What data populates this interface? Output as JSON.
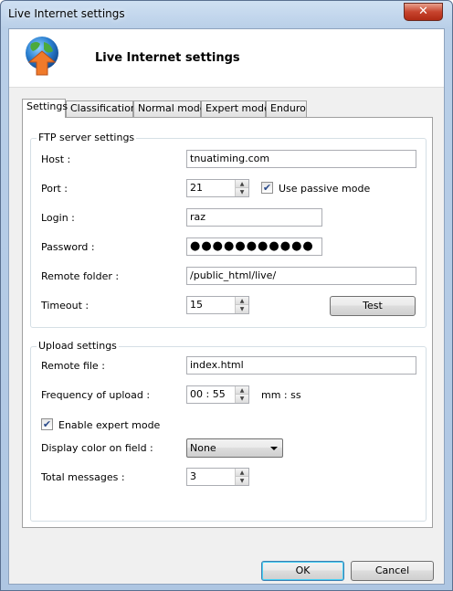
{
  "window": {
    "title": "Live Internet settings",
    "close_glyph": "✕"
  },
  "header": {
    "title": "Live Internet settings",
    "icon": "globe-upload-icon"
  },
  "tabs": [
    {
      "label": "Settings",
      "active": true
    },
    {
      "label": "Classification",
      "active": false
    },
    {
      "label": "Normal mode",
      "active": false
    },
    {
      "label": "Expert mode",
      "active": false
    },
    {
      "label": "Enduro",
      "active": false
    }
  ],
  "ftp": {
    "group_title": "FTP server settings",
    "host_label": "Host :",
    "host_value": "tnuatiming.com",
    "port_label": "Port :",
    "port_value": "21",
    "passive_label": "Use passive mode",
    "passive_checked": true,
    "login_label": "Login :",
    "login_value": "raz",
    "password_label": "Password :",
    "password_value": "●●●●●●●●●●●",
    "folder_label": "Remote folder :",
    "folder_value": "/public_html/live/",
    "timeout_label": "Timeout :",
    "timeout_value": "15",
    "test_label": "Test"
  },
  "upload": {
    "group_title": "Upload settings",
    "file_label": "Remote file :",
    "file_value": "index.html",
    "freq_label": "Frequency of upload :",
    "freq_value": "00 : 55",
    "freq_unit": "mm : ss",
    "expert_label": "Enable expert mode",
    "expert_checked": true,
    "color_label": "Display color on field :",
    "color_value": "None",
    "messages_label": "Total messages :",
    "messages_value": "3"
  },
  "footer": {
    "ok_label": "OK",
    "cancel_label": "Cancel"
  },
  "glyphs": {
    "check": "✔",
    "up": "▲",
    "down": "▼"
  }
}
